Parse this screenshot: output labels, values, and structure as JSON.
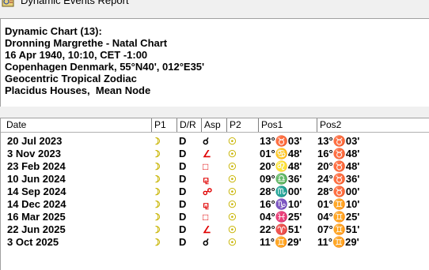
{
  "window": {
    "title": "Dynamic Events Report",
    "icon": "app-report-icon"
  },
  "chart_info": {
    "lines": [
      "Dynamic Chart (13):",
      "Dronning Margrethe - Natal Chart",
      "16 Apr 1940, 10:10, CET -1:00",
      "Copenhagen Denmark, 55°N40', 012°E35'",
      "Geocentric Tropical Zodiac",
      "Placidus Houses,  Mean Node"
    ]
  },
  "table": {
    "columns": [
      "Date",
      "P1",
      "D/R",
      "Asp",
      "P2",
      "Pos1",
      "Pos2"
    ],
    "rows": [
      {
        "date": "20 Jul 2023",
        "p1": "☽",
        "dr": "D",
        "asp": "☌",
        "asp_color": "#000000",
        "p2": "☉",
        "pos1": "13°♉03'",
        "pos2": "13°♉03'"
      },
      {
        "date": "3 Nov 2023",
        "p1": "☽",
        "dr": "D",
        "asp": "∠",
        "asp_color": "#e00000",
        "p2": "☉",
        "pos1": "01°♋48'",
        "pos2": "16°♉48'"
      },
      {
        "date": "23 Feb 2024",
        "p1": "☽",
        "dr": "D",
        "asp": "□",
        "asp_color": "#e00000",
        "p2": "☉",
        "pos1": "20°♌48'",
        "pos2": "20°♉48'"
      },
      {
        "date": "10 Jun 2024",
        "p1": "☽",
        "dr": "D",
        "asp": "⚼",
        "asp_color": "#e00000",
        "p2": "☉",
        "pos1": "09°♎36'",
        "pos2": "24°♉36'"
      },
      {
        "date": "14 Sep 2024",
        "p1": "☽",
        "dr": "D",
        "asp": "☍",
        "asp_color": "#e00000",
        "p2": "☉",
        "pos1": "28°♏00'",
        "pos2": "28°♉00'"
      },
      {
        "date": "14 Dec 2024",
        "p1": "☽",
        "dr": "D",
        "asp": "⚼",
        "asp_color": "#e00000",
        "p2": "☉",
        "pos1": "16°♑10'",
        "pos2": "01°♊10'"
      },
      {
        "date": "16 Mar 2025",
        "p1": "☽",
        "dr": "D",
        "asp": "□",
        "asp_color": "#e00000",
        "p2": "☉",
        "pos1": "04°♓25'",
        "pos2": "04°♊25'"
      },
      {
        "date": "22 Jun 2025",
        "p1": "☽",
        "dr": "D",
        "asp": "∠",
        "asp_color": "#e00000",
        "p2": "☉",
        "pos1": "22°♈51'",
        "pos2": "07°♊51'"
      },
      {
        "date": "3 Oct 2025",
        "p1": "☽",
        "dr": "D",
        "asp": "☌",
        "asp_color": "#000000",
        "p2": "☉",
        "pos1": "11°♊29'",
        "pos2": "11°♊29'"
      }
    ]
  },
  "colors": {
    "planet_glyph": "#c8b400",
    "hard_aspect": "#e00000"
  }
}
